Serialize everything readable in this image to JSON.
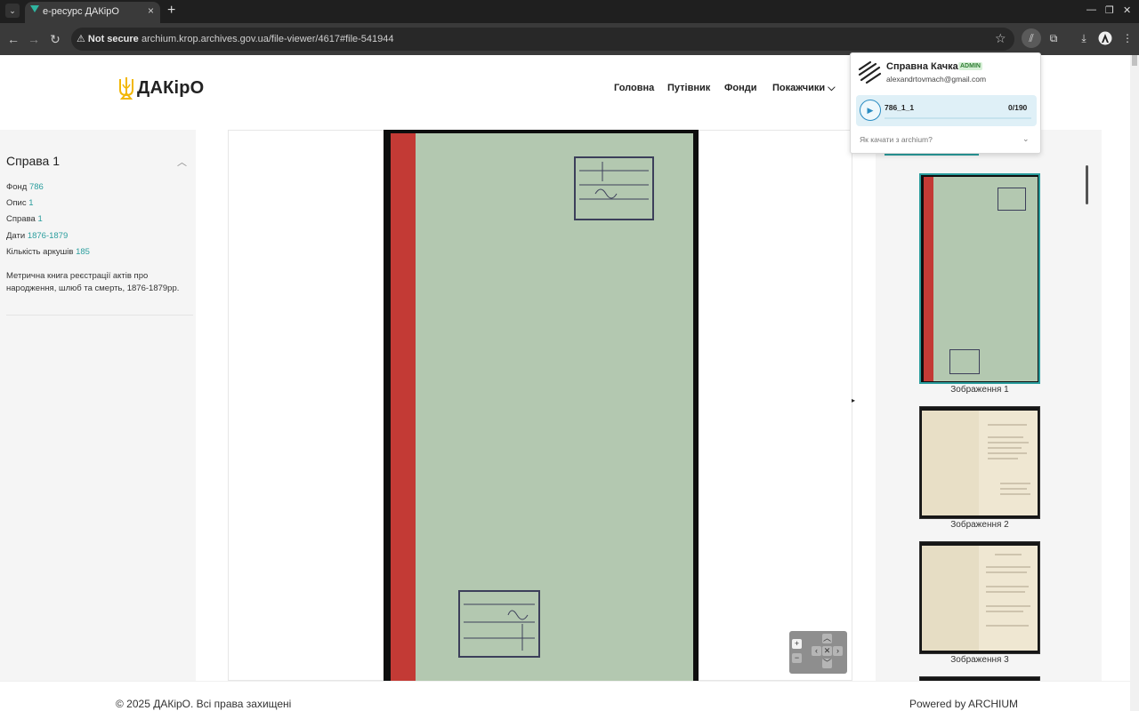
{
  "browser": {
    "tab_title": "е-ресурс ДАКірО",
    "tab_close": "×",
    "new_tab": "+",
    "not_secure": "⚠ Not secure",
    "url": "archium.krop.archives.gov.ua/file-viewer/4617#file-541944"
  },
  "site": {
    "logo_text": "ДАКірО",
    "nav": [
      "Головна",
      "Путівник",
      "Фонди",
      "Покажчики"
    ]
  },
  "case": {
    "title": "Справа 1",
    "fields": [
      {
        "label": "Фонд",
        "value": "786"
      },
      {
        "label": "Опис",
        "value": "1"
      },
      {
        "label": "Справа",
        "value": "1"
      },
      {
        "label": "Дати",
        "value": "1876-1879"
      },
      {
        "label": "Кількість аркушів",
        "value": "185"
      }
    ],
    "description": "Метрична книга реєстрації актів про народження, шлюб та смерть, 1876-1879рр."
  },
  "thumbnails": [
    {
      "label": "Зображення 1"
    },
    {
      "label": "Зображення 2"
    },
    {
      "label": "Зображення 3"
    }
  ],
  "footer": {
    "copyright": "© 2025 ДАКірО. Всі права захищені",
    "powered": "Powered by ARCHIUM"
  },
  "popup": {
    "user_name": "Справна Качка",
    "badge": "ADMIN",
    "email": "alexandrtovmach@gmail.com",
    "task_name": "786_1_1",
    "task_count": "0/190",
    "task_progress": 0,
    "help": "Як качати з archium?"
  },
  "colors": {
    "accent": "#2a9d9d",
    "spine": "#c33a35",
    "cover": "#b3c8b0"
  }
}
